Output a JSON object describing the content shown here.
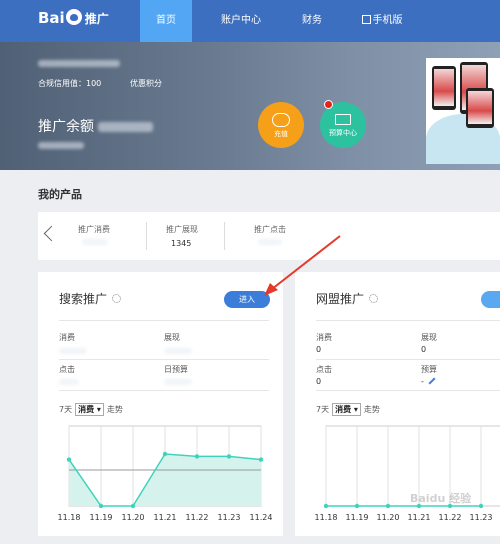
{
  "brand": {
    "logo_text": "Bai",
    "logo_suffix": "推广"
  },
  "nav": {
    "items": [
      "首页",
      "账户中心",
      "财务",
      "手机版"
    ],
    "active": 0,
    "mobile_icon": "qr-icon"
  },
  "banner": {
    "credit_label": "合规信用值：100",
    "points_label": "优惠积分",
    "balance_label": "推广余额",
    "recharge_label": "充值",
    "budget_label": "预算中心"
  },
  "products": {
    "section_title": "我的产品",
    "summary": [
      {
        "label": "推广消费",
        "value": ""
      },
      {
        "label": "推广展现",
        "value": "1345"
      },
      {
        "label": "推广点击",
        "value": ""
      }
    ]
  },
  "search_card": {
    "title": "搜索推广",
    "enter_label": "进入",
    "fields": [
      {
        "label": "消费",
        "value": ""
      },
      {
        "label": "展现",
        "value": ""
      },
      {
        "label": "点击",
        "value": ""
      },
      {
        "label": "日预算",
        "value": ""
      }
    ],
    "trend": {
      "days": "7天",
      "metric": "消费",
      "suffix": "走势"
    }
  },
  "union_card": {
    "title": "网盟推广",
    "fields": [
      {
        "label": "消费",
        "value": "0"
      },
      {
        "label": "展现",
        "value": "0"
      },
      {
        "label": "点击",
        "value": "0"
      },
      {
        "label": "预算",
        "value": "-"
      }
    ],
    "trend": {
      "days": "7天",
      "metric": "消费",
      "suffix": "走势"
    }
  },
  "colors": {
    "nav_bg": "#3d6fc1",
    "nav_active": "#52a6f4",
    "accent": "#3b7dd8",
    "line": "#3fd3bd",
    "area": "#d6f2ec"
  },
  "chart_data": [
    {
      "type": "area",
      "categories": [
        "11.18",
        "11.19",
        "11.20",
        "11.21",
        "11.22",
        "11.23",
        "11.24"
      ],
      "values": [
        0.58,
        0,
        0,
        0.65,
        0.62,
        0.62,
        0.58
      ],
      "reference_line": 0.45,
      "ylim": [
        0,
        1
      ],
      "grid": true
    },
    {
      "type": "area",
      "categories": [
        "11.18",
        "11.19",
        "11.20",
        "11.21",
        "11.22",
        "11.23"
      ],
      "values": [
        0,
        0,
        0,
        0,
        0,
        0
      ],
      "ylim": [
        0,
        1
      ],
      "grid": true
    }
  ],
  "watermark": "Baidu 经验"
}
